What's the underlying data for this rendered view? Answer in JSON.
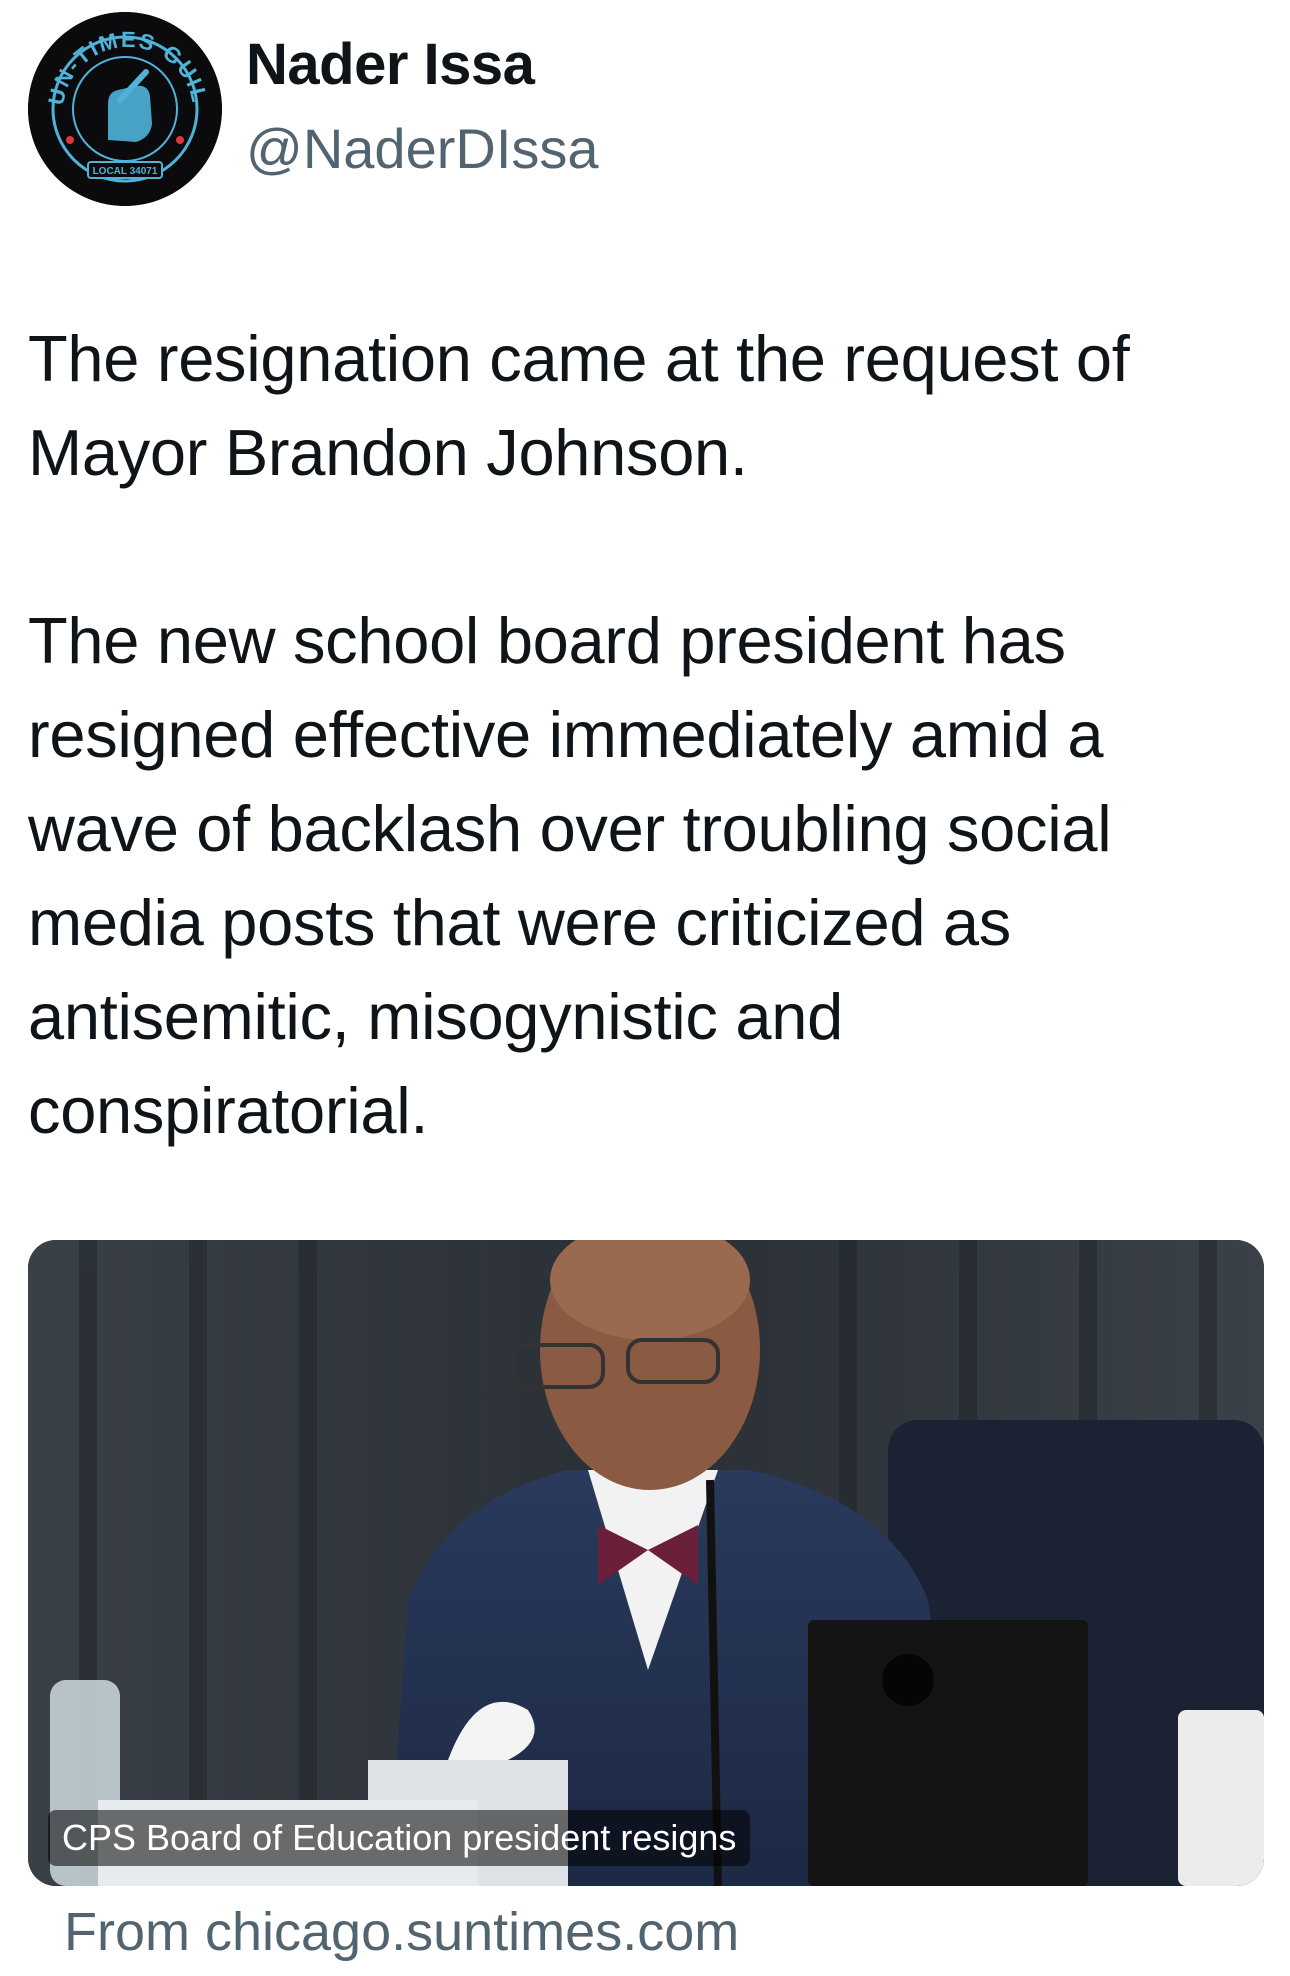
{
  "tweet": {
    "author": {
      "display_name": "Nader Issa",
      "handle": "@NaderDIssa",
      "avatar_icon": "sun-times-guild-logo",
      "avatar_text_top": "SUN-TIMES GUILD",
      "avatar_text_bottom": "LOCAL 34071"
    },
    "paragraphs": [
      "The resignation came at the request of\nMayor Brandon Johnson.",
      "The new school board president has\nresigned effective immediately amid a\nwave of backlash over troubling social\nmedia posts that were criticized as\nantisemitic, misogynistic and\nconspiratorial."
    ]
  },
  "link_card": {
    "title": "CPS Board of Education president resigns",
    "source": "From chicago.suntimes.com"
  },
  "colors": {
    "text": "#0f1419",
    "secondary": "#536471",
    "avatar_ring": "#4fb3d9"
  }
}
